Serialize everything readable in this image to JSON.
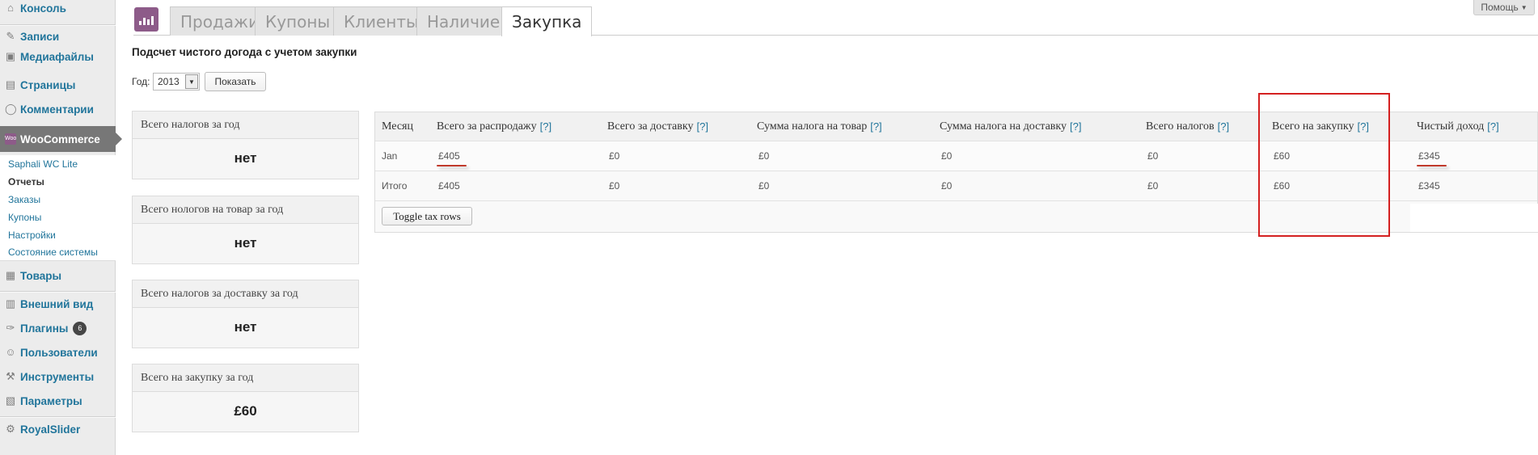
{
  "sidebar": {
    "items": [
      {
        "label": "Консоль",
        "icon": "home-icon",
        "glyph": "⌂"
      },
      {
        "label": "Записи",
        "icon": "pin-icon",
        "glyph": "✎"
      },
      {
        "label": "Медиафайлы",
        "icon": "media-icon",
        "glyph": "▣"
      },
      {
        "label": "Страницы",
        "icon": "pages-icon",
        "glyph": "▤"
      },
      {
        "label": "Комментарии",
        "icon": "comments-icon",
        "glyph": "◯"
      },
      {
        "label": "WooCommerce",
        "icon": "woocommerce-icon",
        "glyph": "Woo"
      },
      {
        "label": "Товары",
        "icon": "products-icon",
        "glyph": "▦"
      },
      {
        "label": "Внешний вид",
        "icon": "appearance-icon",
        "glyph": "▥"
      },
      {
        "label": "Плагины",
        "icon": "plugins-icon",
        "glyph": "✑",
        "badge": "6"
      },
      {
        "label": "Пользователи",
        "icon": "users-icon",
        "glyph": "☺"
      },
      {
        "label": "Инструменты",
        "icon": "tools-icon",
        "glyph": "⚒"
      },
      {
        "label": "Параметры",
        "icon": "settings-icon",
        "glyph": "▧"
      },
      {
        "label": "RoyalSlider",
        "icon": "gear-icon",
        "glyph": "⚙"
      }
    ],
    "submenu": [
      "Saphali WC Lite",
      "Отчеты",
      "Заказы",
      "Купоны",
      "Настройки",
      "Состояние системы"
    ]
  },
  "tabs": [
    "Продажи",
    "Купоны",
    "Клиенты",
    "Наличие",
    "Закупка"
  ],
  "help_label": "Помощь",
  "title": "Подсчет чистого догода с учетом закупки",
  "year_form": {
    "label": "Год:",
    "selected": "2013",
    "button": "Показать"
  },
  "summary": [
    {
      "label": "Всего налогов за год",
      "value": "нет"
    },
    {
      "label": "Всего нологов на товар за год",
      "value": "нет"
    },
    {
      "label": "Всего налогов за доставку за год",
      "value": "нет"
    },
    {
      "label": "Всего на закупку за год",
      "value": "£60"
    }
  ],
  "table": {
    "help_mark": "[?]",
    "headers": [
      "Месяц",
      "Всего за распродажу",
      "Всего за доставку",
      "Сумма налога на товар",
      "Сумма налога на доставку",
      "Всего налогов",
      "Всего на закупку",
      "Чистый доход"
    ],
    "rows": [
      [
        "Jan",
        "£405",
        "£0",
        "£0",
        "£0",
        "£0",
        "£60",
        "£345"
      ],
      [
        "Итого",
        "£405",
        "£0",
        "£0",
        "£0",
        "£0",
        "£60",
        "£345"
      ]
    ],
    "toggle_button": "Toggle tax rows"
  },
  "colors": {
    "accent": "#8d5b89",
    "link": "#21759b",
    "highlight": "#d42020"
  }
}
